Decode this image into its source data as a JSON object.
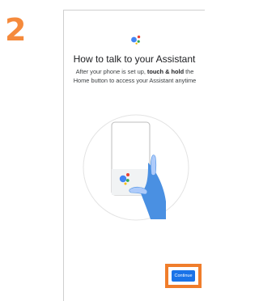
{
  "step": {
    "number": "2",
    "color": "#f58a3c"
  },
  "screen": {
    "logo_icon": "google-assistant-icon",
    "heading": "How to talk to your Assistant",
    "description": {
      "before": "After your phone is set up, ",
      "emphasis": "touch & hold",
      "after": " the Home button to access your Assistant anytime"
    },
    "illustration_icon": "hand-holding-phone-illustration",
    "continue_label": "Continue",
    "accent_color": "#1a73e8",
    "highlight_color": "#f07d2b"
  }
}
